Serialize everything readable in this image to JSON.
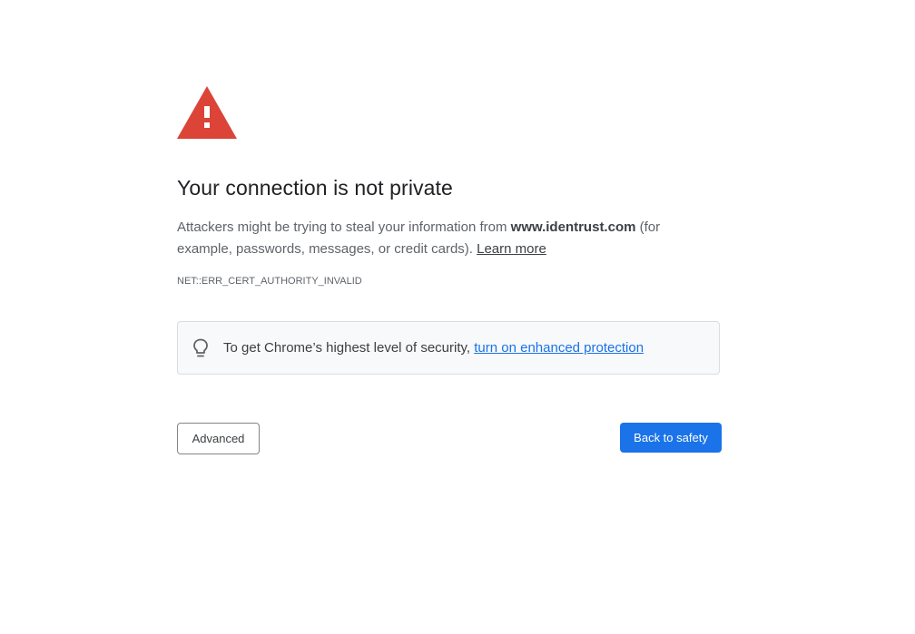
{
  "title": "Your connection is not private",
  "description": {
    "before": "Attackers might be trying to steal your information from ",
    "domain": "www.identrust.com",
    "after": " (for example, passwords, messages, or credit cards). ",
    "learn_more": "Learn more"
  },
  "error_code": "NET::ERR_CERT_AUTHORITY_INVALID",
  "security_tip": {
    "text": "To get Chrome’s highest level of security, ",
    "link": "turn on enhanced protection",
    "icon": "lightbulb-icon"
  },
  "buttons": {
    "advanced": "Advanced",
    "back_to_safety": "Back to safety"
  },
  "colors": {
    "warning_red": "#db4437",
    "accent_blue": "#1a73e8",
    "text_dark": "#202124",
    "text_muted": "#5f6368"
  },
  "icons": {
    "warning": "warning-triangle-icon"
  }
}
